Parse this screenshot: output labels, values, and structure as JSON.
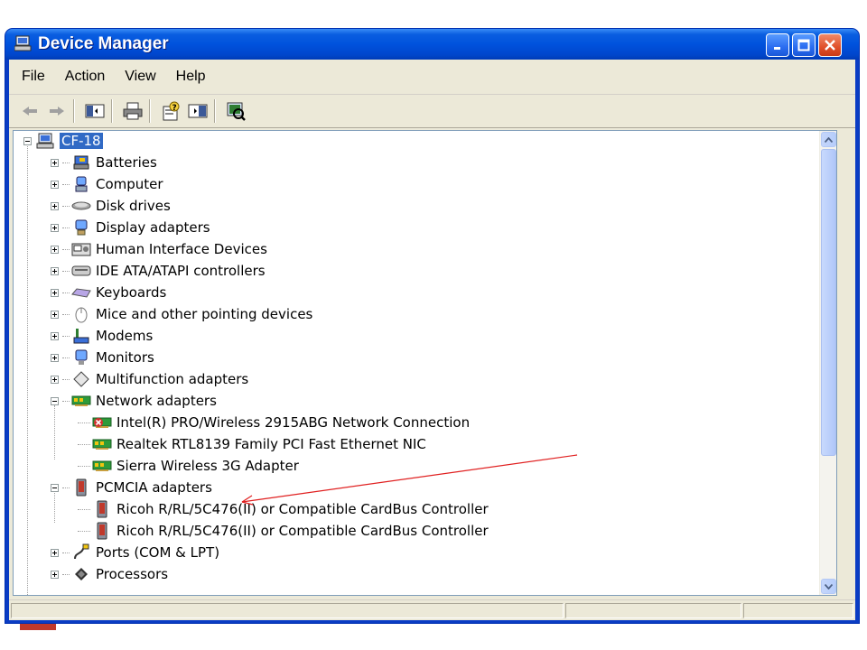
{
  "window": {
    "title": "Device Manager"
  },
  "menu": {
    "items": [
      "File",
      "Action",
      "View",
      "Help"
    ]
  },
  "toolbar": {
    "buttons": [
      "back-arrow-icon",
      "forward-arrow-icon",
      "show-hide-tree-icon",
      "print-icon",
      "help-properties-icon",
      "details-view-icon",
      "scan-hardware-icon"
    ]
  },
  "tree": {
    "root": "CF-18",
    "categories": [
      {
        "label": "Batteries",
        "icon": "battery-icon",
        "expanded": false
      },
      {
        "label": "Computer",
        "icon": "computer-icon",
        "expanded": false
      },
      {
        "label": "Disk drives",
        "icon": "disk-drive-icon",
        "expanded": false
      },
      {
        "label": "Display adapters",
        "icon": "display-adapter-icon",
        "expanded": false
      },
      {
        "label": "Human Interface Devices",
        "icon": "hid-icon",
        "expanded": false
      },
      {
        "label": "IDE ATA/ATAPI controllers",
        "icon": "ide-controller-icon",
        "expanded": false
      },
      {
        "label": "Keyboards",
        "icon": "keyboard-icon",
        "expanded": false
      },
      {
        "label": "Mice and other pointing devices",
        "icon": "mouse-icon",
        "expanded": false
      },
      {
        "label": "Modems",
        "icon": "modem-icon",
        "expanded": false
      },
      {
        "label": "Monitors",
        "icon": "monitor-icon",
        "expanded": false
      },
      {
        "label": "Multifunction adapters",
        "icon": "multifunction-icon",
        "expanded": false
      },
      {
        "label": "Network adapters",
        "icon": "network-adapter-icon",
        "expanded": true,
        "children": [
          {
            "label": "Intel(R) PRO/Wireless 2915ABG Network Connection",
            "icon": "network-adapter-disabled-icon"
          },
          {
            "label": "Realtek RTL8139 Family PCI Fast Ethernet NIC",
            "icon": "network-adapter-icon"
          },
          {
            "label": "Sierra Wireless 3G Adapter",
            "icon": "network-adapter-icon"
          }
        ]
      },
      {
        "label": "PCMCIA adapters",
        "icon": "pcmcia-icon",
        "expanded": true,
        "children": [
          {
            "label": "Ricoh R/RL/5C476(II) or Compatible CardBus Controller",
            "icon": "pcmcia-icon"
          },
          {
            "label": "Ricoh R/RL/5C476(II) or Compatible CardBus Controller",
            "icon": "pcmcia-icon"
          }
        ]
      },
      {
        "label": "Ports (COM & LPT)",
        "icon": "port-icon",
        "expanded": false
      },
      {
        "label": "Processors",
        "icon": "processor-icon",
        "expanded": false
      }
    ]
  },
  "background": {
    "bottom_text": "Ricoh R/RL/5C476(II) or Compatible CardBus Controller"
  },
  "colors": {
    "selection": "#316ac5",
    "titlebar": "#0052dd",
    "annotation_arrow": "#e02020"
  }
}
